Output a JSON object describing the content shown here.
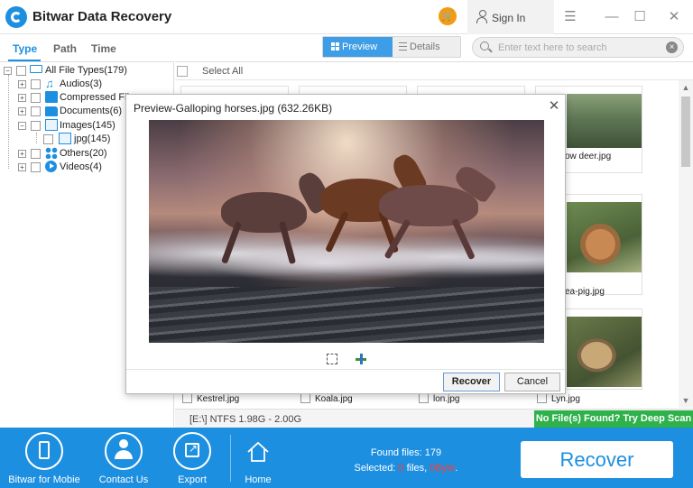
{
  "app": {
    "title": "Bitwar Data Recovery"
  },
  "window": {
    "signin_label": "Sign In",
    "menu_glyph": "☰",
    "min_glyph": "—",
    "max_glyph": "☐",
    "close_glyph": "✕",
    "cart_glyph": "🛒"
  },
  "toolbar": {
    "tabs": [
      {
        "label": "Type",
        "active": true
      },
      {
        "label": "Path"
      },
      {
        "label": "Time"
      }
    ],
    "view_preview": "Preview",
    "view_details": "Details",
    "search_placeholder": "Enter text here to search"
  },
  "tree": {
    "root": "All File Types(179)",
    "items": [
      {
        "label": "Audios(3)",
        "icon": "music-icon"
      },
      {
        "label": "Compressed File",
        "icon": "zip-icon"
      },
      {
        "label": "Documents(6)",
        "icon": "folder-icon"
      },
      {
        "label": "Images(145)",
        "icon": "image-icon"
      },
      {
        "label": "jpg(145)",
        "icon": "image-icon"
      },
      {
        "label": "Others(20)",
        "icon": "dots-icon"
      },
      {
        "label": "Videos(4)",
        "icon": "video-icon"
      }
    ],
    "expander_plus": "+",
    "expander_minus": "−"
  },
  "main": {
    "select_all": "Select All",
    "cards": [
      {
        "label": "ow deer.jpg"
      },
      {
        "label": "ea-pig.jpg"
      }
    ],
    "files": [
      "Kestrel.jpg",
      "Koala.jpg",
      "lon.jpg",
      "Lyn.jpg"
    ],
    "drive_info": "[E:\\] NTFS 1.98G - 2.00G",
    "deep_scan": "No File(s) Found? Try Deep Scan"
  },
  "bottom": {
    "items": [
      "Bitwar for Mobie",
      "Contact Us",
      "Export",
      "Home"
    ],
    "found_prefix": "Found files: ",
    "found_count": "179",
    "selected_prefix": "Selected: ",
    "selected_count": "0",
    "selected_mid": " files, ",
    "selected_size": "0Byte",
    "selected_end": ".",
    "recover": "Recover"
  },
  "modal": {
    "title": "Preview-Galloping horses.jpg (632.26KB)",
    "close_glyph": "✕",
    "recover": "Recover",
    "cancel": "Cancel"
  },
  "colors": {
    "accent": "#1d8fe1",
    "deep_scan": "#2fb14b",
    "cart": "#f39c12",
    "selected_red": "#ff3b30"
  }
}
